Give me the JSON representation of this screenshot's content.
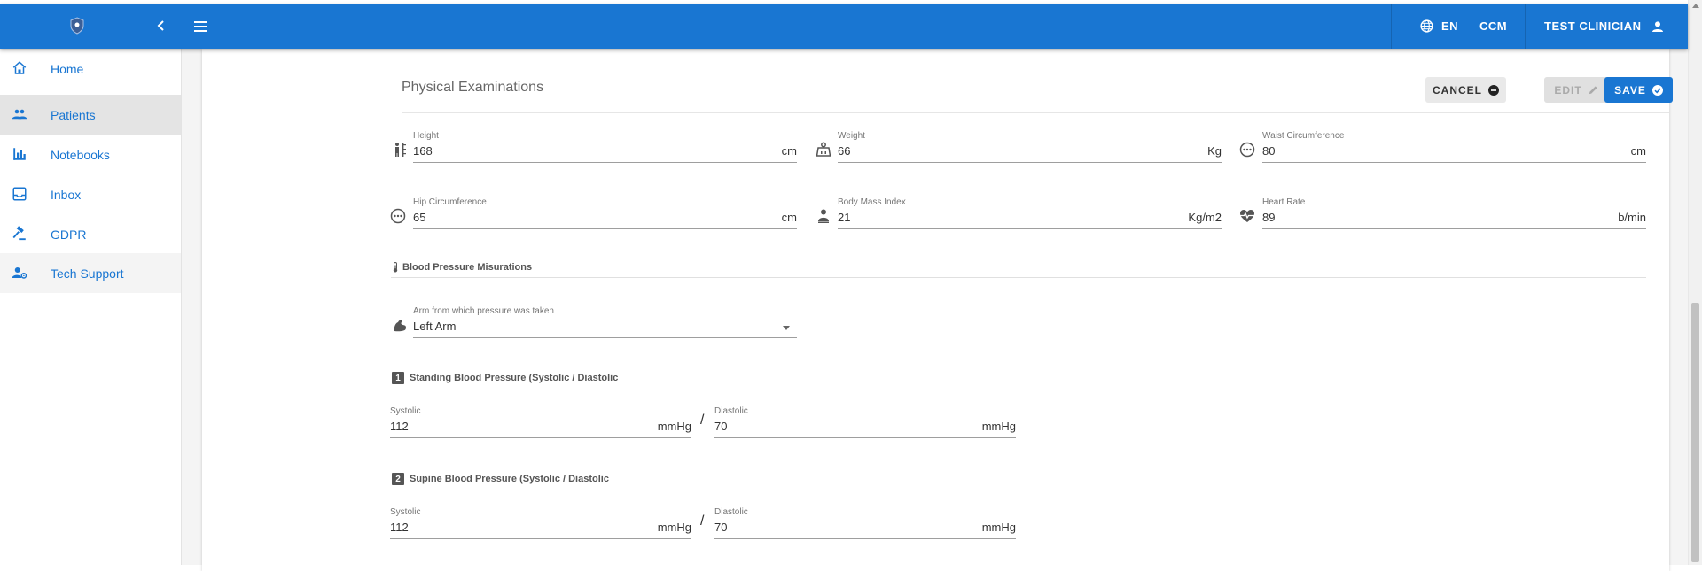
{
  "colors": {
    "primary": "#1976d2",
    "sidebar_active": "#e4e4e4",
    "save_button": "#1976d2"
  },
  "topbar": {
    "logo_icon": "shield-logo-icon",
    "collapse_icon": "chevron-left-icon",
    "menu_icon": "hamburger-menu-icon",
    "language": "EN",
    "org": "CCM",
    "user": "TEST CLINICIAN"
  },
  "sidebar": {
    "items": [
      {
        "label": "Home",
        "icon": "home-icon"
      },
      {
        "label": "Patients",
        "icon": "people-icon",
        "active": true
      },
      {
        "label": "Notebooks",
        "icon": "bar-chart-icon"
      },
      {
        "label": "Inbox",
        "icon": "inbox-icon"
      },
      {
        "label": "GDPR",
        "icon": "gavel-icon"
      },
      {
        "label": "Tech Support",
        "icon": "support-person-icon"
      }
    ]
  },
  "card": {
    "title": "Physical Examinations",
    "buttons": {
      "cancel": "CANCEL",
      "edit": "EDIT",
      "save": "SAVE"
    },
    "fields": {
      "height": {
        "label": "Height",
        "value": "168",
        "unit": "cm"
      },
      "weight": {
        "label": "Weight",
        "value": "66",
        "unit": "Kg"
      },
      "waist": {
        "label": "Waist Circumference",
        "value": "80",
        "unit": "cm"
      },
      "hip": {
        "label": "Hip Circumference",
        "value": "65",
        "unit": "cm"
      },
      "bmi": {
        "label": "Body Mass Index",
        "value": "21",
        "unit": "Kg/m2"
      },
      "heart_rate": {
        "label": "Heart Rate",
        "value": "89",
        "unit": "b/min"
      }
    },
    "bp": {
      "section_title": "Blood Pressure Misurations",
      "arm": {
        "label": "Arm from which pressure was taken",
        "value": "Left Arm"
      },
      "standing": {
        "number": "1",
        "title": "Standing Blood Pressure (Systolic / Diastolic",
        "systolic": {
          "label": "Systolic",
          "value": "112",
          "unit": "mmHg"
        },
        "diastolic": {
          "label": "Diastolic",
          "value": "70",
          "unit": "mmHg"
        }
      },
      "supine": {
        "number": "2",
        "title": "Supine Blood Pressure (Systolic / Diastolic",
        "systolic": {
          "label": "Systolic",
          "value": "112",
          "unit": "mmHg"
        },
        "diastolic": {
          "label": "Diastolic",
          "value": "70",
          "unit": "mmHg"
        }
      },
      "separator": "/"
    }
  }
}
